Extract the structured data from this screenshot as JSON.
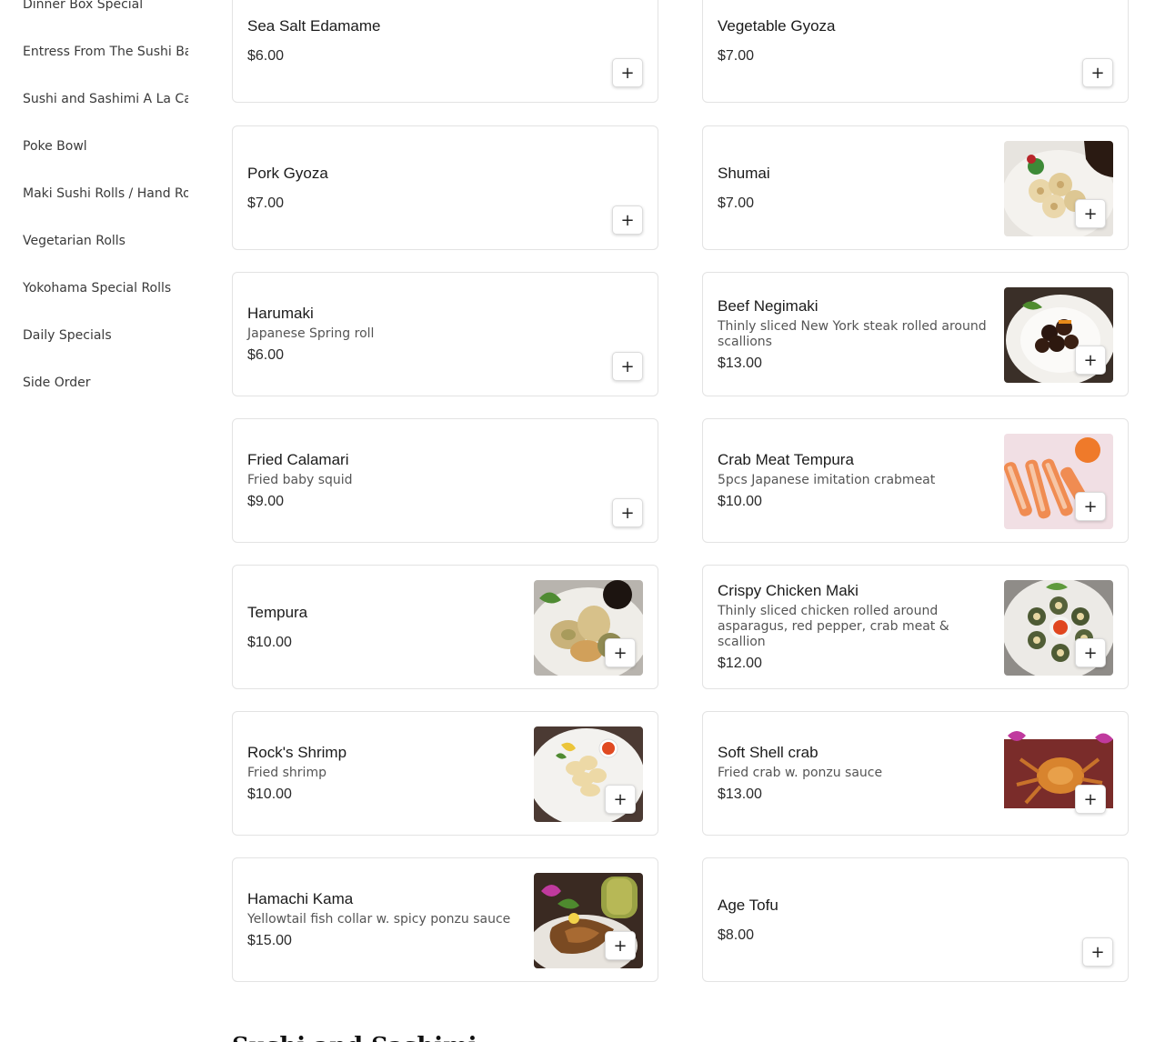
{
  "sidebar": {
    "items": [
      {
        "label": "Dinner Box Special"
      },
      {
        "label": "Entress From The Sushi Bar"
      },
      {
        "label": "Sushi and Sashimi A La Carte"
      },
      {
        "label": "Poke Bowl"
      },
      {
        "label": "Maki Sushi Rolls / Hand Rolls"
      },
      {
        "label": "Vegetarian Rolls"
      },
      {
        "label": "Yokohama Special Rolls"
      },
      {
        "label": "Daily Specials"
      },
      {
        "label": "Side Order"
      }
    ]
  },
  "menu": {
    "add_label": "+",
    "items": [
      {
        "name": "Sea Salt Edamame",
        "description": "",
        "price": "$6.00",
        "image": "none"
      },
      {
        "name": "Vegetable Gyoza",
        "description": "",
        "price": "$7.00",
        "image": "none"
      },
      {
        "name": "Pork Gyoza",
        "description": "",
        "price": "$7.00",
        "image": "none"
      },
      {
        "name": "Shumai",
        "description": "",
        "price": "$7.00",
        "image": "shumai-photo"
      },
      {
        "name": "Harumaki",
        "description": "Japanese Spring roll",
        "price": "$6.00",
        "image": "none"
      },
      {
        "name": "Beef Negimaki",
        "description": "Thinly sliced New York steak rolled around scallions",
        "price": "$13.00",
        "image": "beef-negimaki-photo"
      },
      {
        "name": "Fried Calamari",
        "description": "Fried baby squid",
        "price": "$9.00",
        "image": "none"
      },
      {
        "name": "Crab Meat Tempura",
        "description": "5pcs Japanese imitation crabmeat",
        "price": "$10.00",
        "image": "crab-tempura-photo"
      },
      {
        "name": "Tempura",
        "description": "",
        "price": "$10.00",
        "image": "tempura-photo"
      },
      {
        "name": "Crispy Chicken Maki",
        "description": "Thinly sliced chicken rolled around asparagus, red pepper, crab meat & scallion",
        "price": "$12.00",
        "image": "chicken-maki-photo"
      },
      {
        "name": "Rock's Shrimp",
        "description": "Fried shrimp",
        "price": "$10.00",
        "image": "rock-shrimp-photo"
      },
      {
        "name": "Soft Shell crab",
        "description": "Fried crab w. ponzu sauce",
        "price": "$13.00",
        "image": "soft-shell-crab-photo"
      },
      {
        "name": "Hamachi Kama",
        "description": "Yellowtail fish collar w. spicy ponzu sauce",
        "price": "$15.00",
        "image": "hamachi-kama-photo"
      },
      {
        "name": "Age Tofu",
        "description": "",
        "price": "$8.00",
        "image": "none"
      }
    ]
  },
  "next_section": {
    "title": "Sushi and Sashimi"
  }
}
